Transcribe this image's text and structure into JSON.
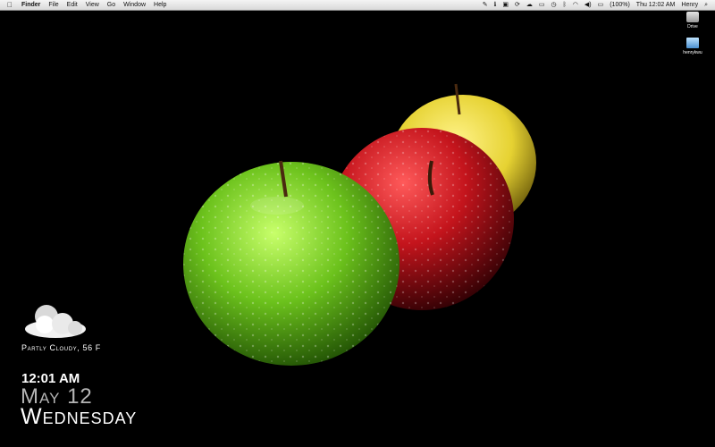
{
  "menubar": {
    "apple_icon": "apple-logo-icon",
    "app_name": "Finder",
    "menus": [
      "File",
      "Edit",
      "View",
      "Go",
      "Window",
      "Help"
    ],
    "status": {
      "battery": "(100%)",
      "clock": "Thu 12:02 AM",
      "user": "Henry"
    }
  },
  "desktop_icons": [
    {
      "label": "Drive",
      "icon": "hard-drive-icon"
    },
    {
      "label": "henrykwu",
      "icon": "user-folder-icon"
    }
  ],
  "widgets": {
    "weather": {
      "text": "Partly Cloudy, 56 F",
      "icon": "partly-cloudy-icon"
    },
    "clock": {
      "time": "12:01 AM",
      "date": "May 12",
      "day": "Wednesday"
    }
  },
  "colors": {
    "green_apple": "#6cc21c",
    "red_apple": "#b0101a",
    "yellow_apple": "#e6d232"
  }
}
